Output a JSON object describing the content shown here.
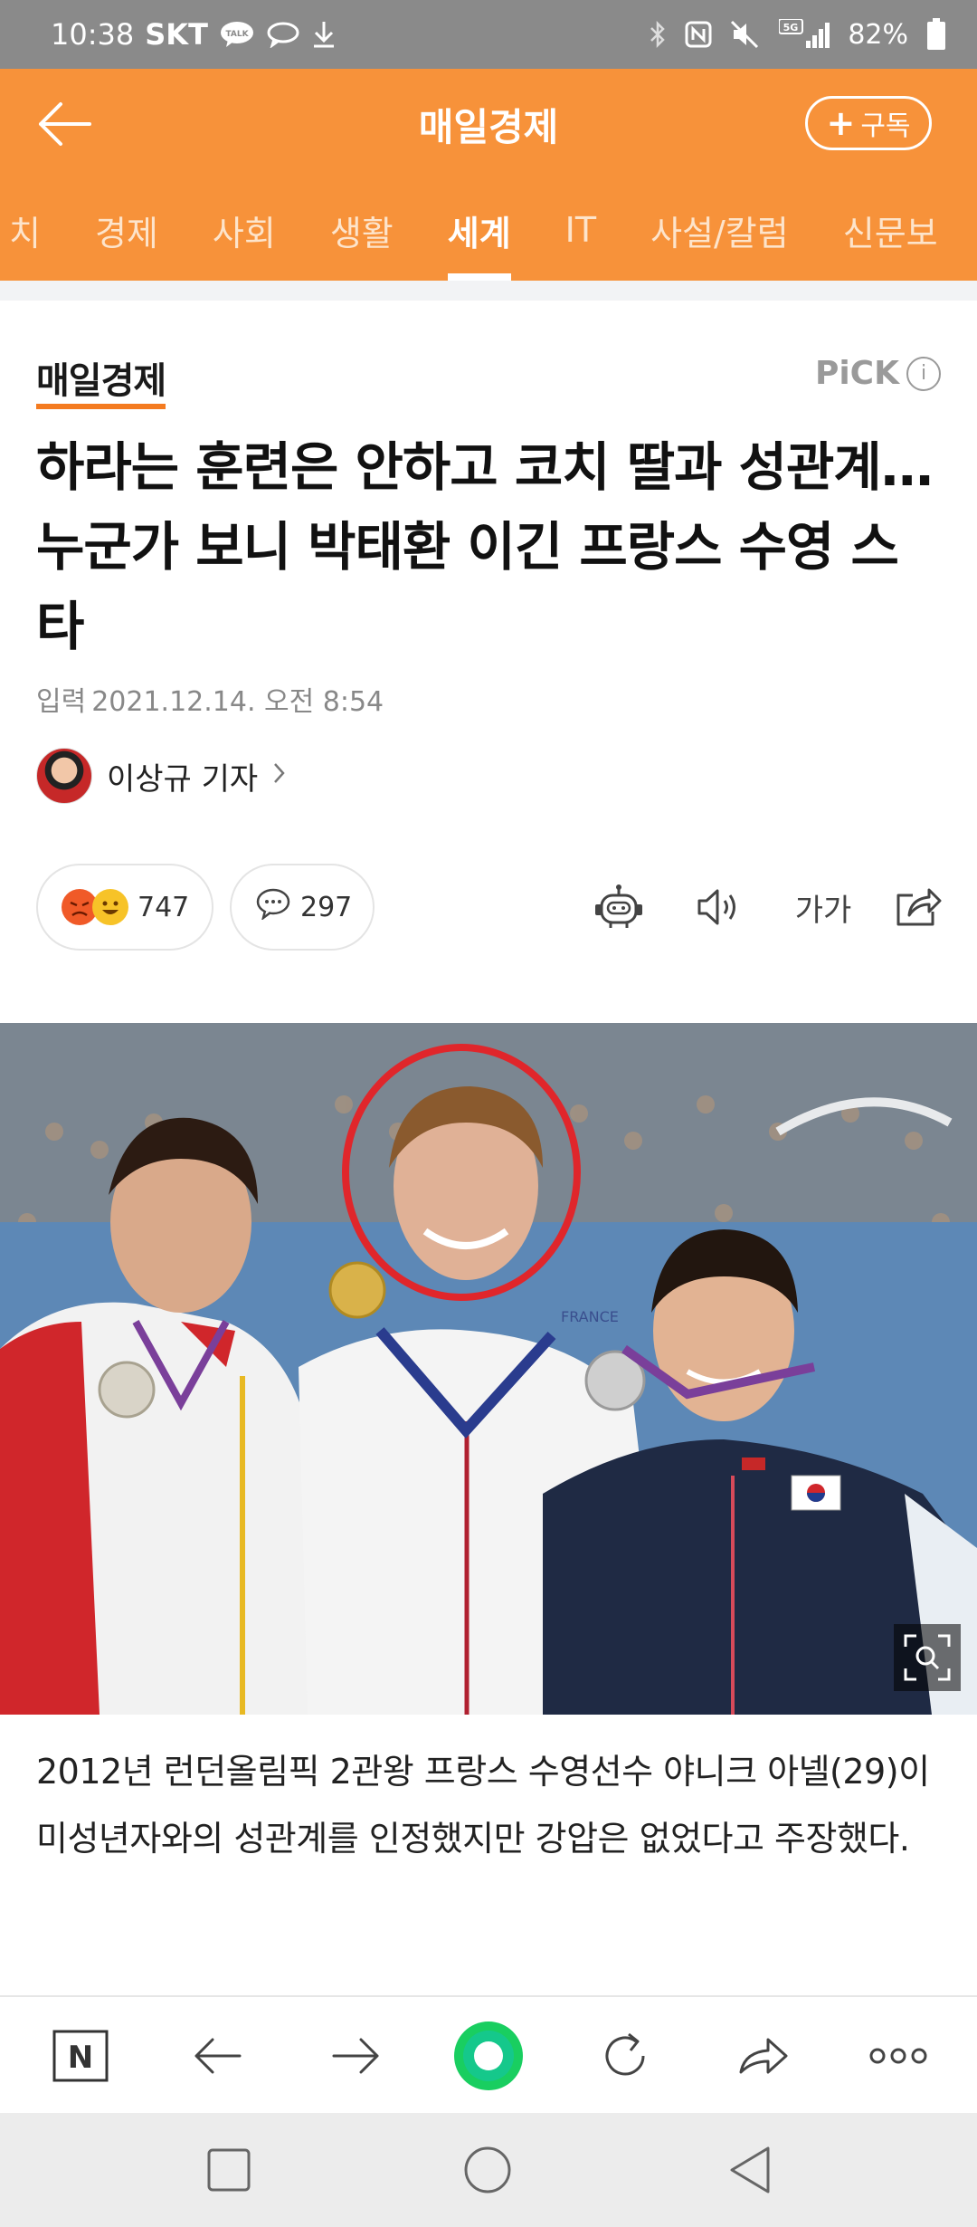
{
  "status_bar": {
    "time": "10:38",
    "carrier": "SKT",
    "talk_badge": "TALK",
    "battery": "82%",
    "network": "5G"
  },
  "header": {
    "title": "매일경제",
    "subscribe_label": "구독",
    "subscribe_plus": "+"
  },
  "categories": [
    "치",
    "경제",
    "사회",
    "생활",
    "세계",
    "IT",
    "사설/칼럼",
    "신문보"
  ],
  "active_category": "세계",
  "article": {
    "press_name": "매일경제",
    "pick_label": "PiCK",
    "pick_info": "i",
    "headline": "하라는 훈련은 안하고 코치 딸과 성관계…누군가 보니 박태환 이긴 프랑스 수영 스타",
    "date_label": "입력",
    "date_value": "2021.12.14. 오전 8:54",
    "reporter": "이상규 기자",
    "reactions_count": "747",
    "comments_count": "297",
    "font_size_label": "가가",
    "caption": "2012년 런던올림픽 2관왕 프랑스 수영선수 야니크 아넬(29)이 미성년자와의 성관계를 인정했지만 강압은 없었다고 주장했다."
  },
  "photo": {
    "jacket_label": "FRANCE"
  },
  "toolbar": {
    "naver_label": "N"
  },
  "colors": {
    "header": "#f7923a",
    "status_bar": "#8a8a8a",
    "accent_green": "#19ce60",
    "circle_highlight": "#e0262b"
  }
}
